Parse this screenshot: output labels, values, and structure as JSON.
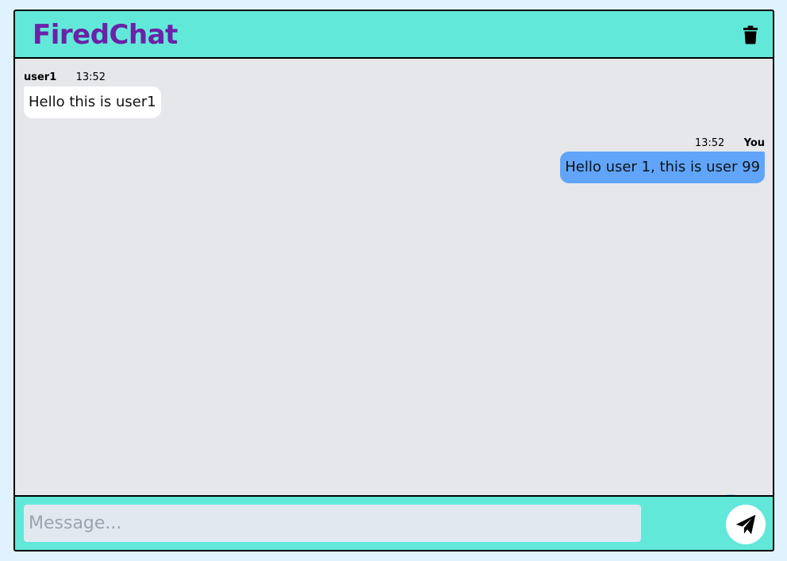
{
  "app": {
    "title": "FiredChat"
  },
  "header": {
    "delete_icon": "trash-icon"
  },
  "messages": [
    {
      "sender": "user1",
      "time": "13:52",
      "text": "Hello this is user1",
      "direction": "incoming"
    },
    {
      "sender": "You",
      "time": "13:52",
      "text": "Hello user 1, this is user 99",
      "direction": "outgoing"
    }
  ],
  "scroll_button": {
    "icon": "arrow-down-icon"
  },
  "composer": {
    "placeholder": "Message...",
    "value": "",
    "send_icon": "paper-plane-icon"
  },
  "colors": {
    "brand_text": "#6b21a8",
    "header_bg": "#62e8d8",
    "chat_bg": "#e5e7eb",
    "outgoing_bubble": "#60a5fa",
    "incoming_bubble": "#ffffff",
    "scroll_button_bg": "#7dd3fc"
  }
}
